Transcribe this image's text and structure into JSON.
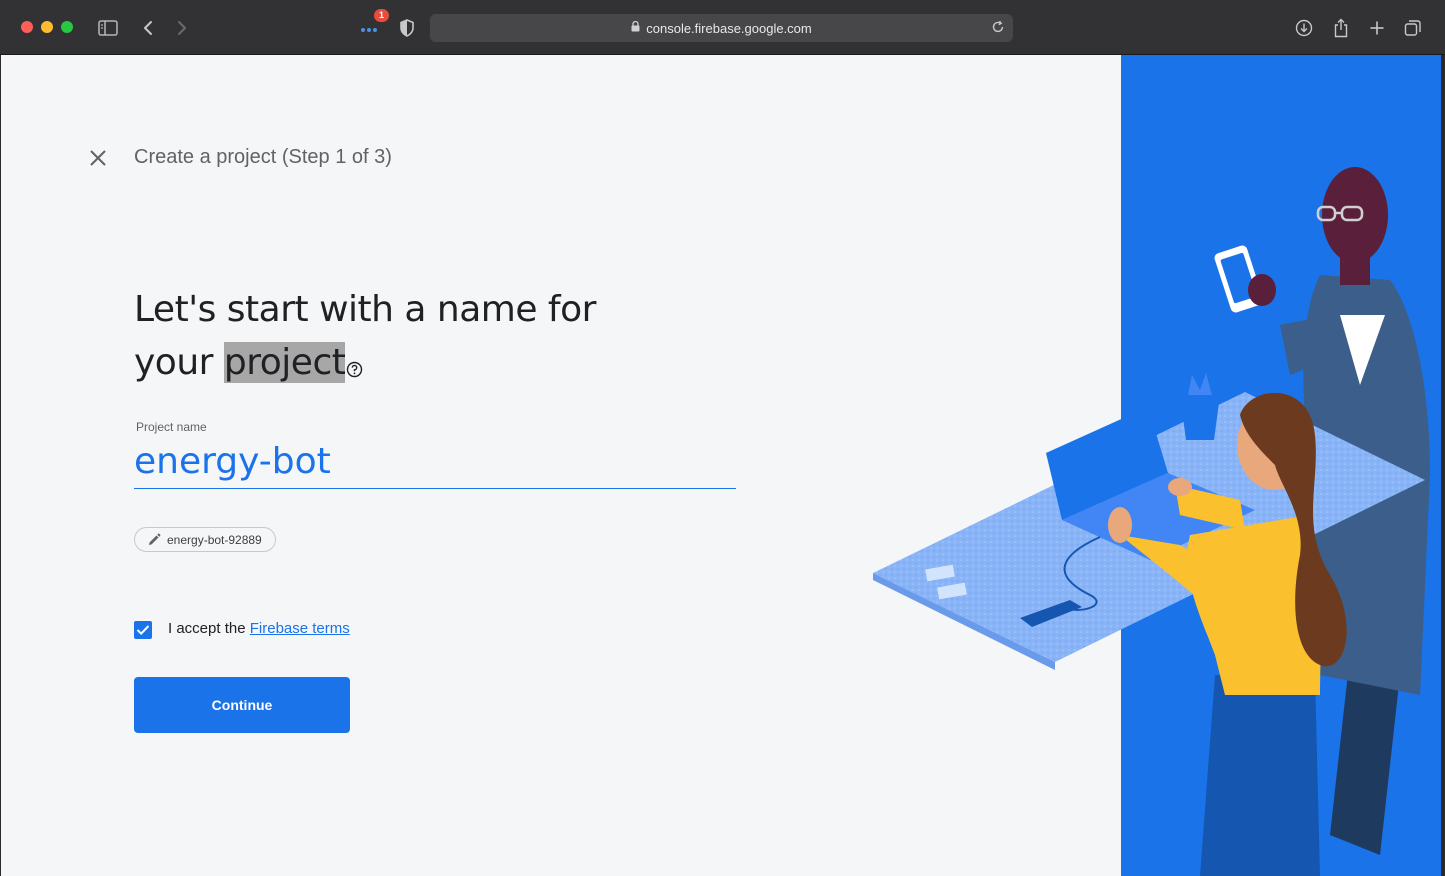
{
  "browser": {
    "url": "console.firebase.google.com",
    "notification_count": "1"
  },
  "page": {
    "step_title": "Create a project (Step 1 of 3)",
    "headline_part1": "Let's start with a name for",
    "headline_part2": "your",
    "headline_highlight": "project",
    "field_label": "Project name",
    "project_name": "energy-bot",
    "project_id": "energy-bot-92889",
    "terms_prefix": "I accept the",
    "terms_link": "Firebase terms",
    "continue_label": "Continue"
  },
  "colors": {
    "primary": "#1a73e8",
    "panel": "#1a73e8",
    "page_bg": "#f5f6f8"
  },
  "icons": [
    "sidebar-icon",
    "back-icon",
    "forward-icon",
    "extensions-icon",
    "shield-icon",
    "lock-icon",
    "reload-icon",
    "download-icon",
    "share-icon",
    "new-tab-icon",
    "tabs-icon",
    "close-icon",
    "help-icon",
    "edit-icon",
    "check-icon"
  ]
}
